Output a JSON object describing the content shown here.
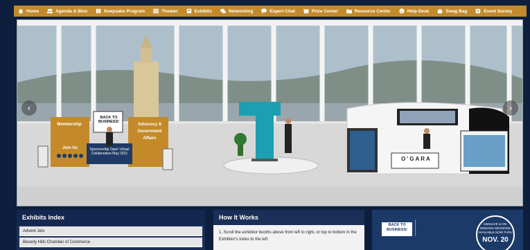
{
  "nav": [
    {
      "label": "Home",
      "icon": "home-icon"
    },
    {
      "label": "Agenda & Bios",
      "icon": "people-icon"
    },
    {
      "label": "Keepsake Program",
      "icon": "book-icon"
    },
    {
      "label": "Theater",
      "icon": "list-icon"
    },
    {
      "label": "Exhibits",
      "icon": "booth-icon"
    },
    {
      "label": "Networking",
      "icon": "chat-bubbles-icon"
    },
    {
      "label": "Expert Chat",
      "icon": "chat-icon"
    },
    {
      "label": "Prize Center",
      "icon": "prize-icon"
    },
    {
      "label": "Resource Center",
      "icon": "folder-icon"
    },
    {
      "label": "Help Desk",
      "icon": "info-icon"
    },
    {
      "label": "Swag Bag",
      "icon": "bag-icon"
    },
    {
      "label": "Event Survey",
      "icon": "survey-icon"
    }
  ],
  "hall": {
    "arrow_left": "‹",
    "arrow_right": "›",
    "booth_left": {
      "membership": "Membership",
      "join_us": "Join Us",
      "back_to_business": "BACK TO BUSINESS!",
      "advocacy": "Advocacy & Government Affairs",
      "sponsorship": "Sponsorship Open Virtual Collaborative May 2021"
    },
    "booth_right": {
      "logo": "O'GARA"
    }
  },
  "exhibits_index": {
    "title": "Exhibits Index",
    "items": [
      "Advent Jets",
      "Beverly Hills Chamber of Commerce"
    ]
  },
  "how_it_works": {
    "title": "How It Works",
    "step1": "1. Scroll the exhibitor booths above from left to right, or top to bottom in the Exhibitor's Index to the left."
  },
  "promo": {
    "back_to_business": "BACK TO BUSINESS!",
    "simulive": "SIMULIVE & ON-DEMAND SESSIONS AVAILABLE NOW THRU",
    "date": "NOV. 20"
  },
  "colors": {
    "nav_bar": "#c38a2c",
    "page_bg": "#0d1f3c",
    "panel_blue": "#1a2f57",
    "booth_gold": "#c48a2a"
  }
}
